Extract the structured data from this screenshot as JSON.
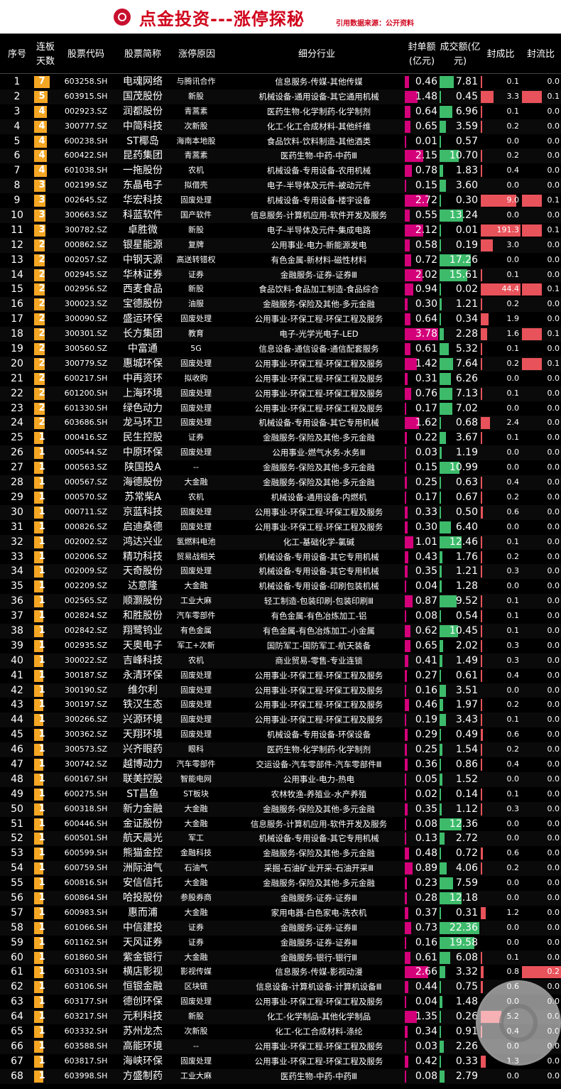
{
  "header": {
    "title": "点金投资---涨停探秘",
    "source": "引用数据来源：公开资料"
  },
  "columns": {
    "seq": "序号",
    "lianban": "连板天数",
    "code": "股票代码",
    "name": "股票简称",
    "reason": "涨停原因",
    "industry": "细分行业",
    "fengdan": "封单额(亿元)",
    "volume": "成交额(亿元)",
    "fengcheng": "封成比",
    "fengliu": "封流比"
  },
  "colors": {
    "lianban": "#f5a623",
    "fengdan": "#d4007a",
    "volume": "#3dbb6b",
    "ratio": "#e8525a",
    "title": "#d0021b"
  },
  "rows": [
    [
      "1",
      "7",
      "603258.SH",
      "电魂网络",
      "与腾讯合作",
      "信息服务-传媒-其他传媒",
      "0.46",
      "7.81",
      "0.1",
      "0.0"
    ],
    [
      "2",
      "5",
      "603915.SH",
      "国茂股份",
      "新股",
      "机械设备-通用设备-其它通用机械",
      "1.48",
      "0.45",
      "3.3",
      "0.1"
    ],
    [
      "3",
      "4",
      "002923.SZ",
      "润都股份",
      "青蒿素",
      "医药生物-化学制药-化学制剂",
      "0.64",
      "6.96",
      "0.1",
      "0.0"
    ],
    [
      "4",
      "4",
      "300777.SZ",
      "中简科技",
      "次新股",
      "化工-化工合成材料-其他纤维",
      "0.65",
      "3.59",
      "0.2",
      "0.0"
    ],
    [
      "5",
      "4",
      "600238.SH",
      "ST椰岛",
      "海南本地股",
      "食品饮料-饮料制造-其他酒类",
      "0.01",
      "0.57",
      "0.0",
      "0.0"
    ],
    [
      "6",
      "4",
      "600422.SH",
      "昆药集团",
      "青蒿素",
      "医药生物-中药-中药Ⅲ",
      "2.15",
      "10.70",
      "0.2",
      "0.0"
    ],
    [
      "7",
      "4",
      "601038.SH",
      "一拖股份",
      "农机",
      "机械设备-专用设备-农用机械",
      "0.78",
      "1.83",
      "0.4",
      "0.0"
    ],
    [
      "8",
      "3",
      "002199.SZ",
      "东晶电子",
      "拟借壳",
      "电子-半导体及元件-被动元件",
      "0.15",
      "3.60",
      "0.0",
      "0.0"
    ],
    [
      "9",
      "3",
      "002645.SZ",
      "华宏科技",
      "固废处理",
      "机械设备-专用设备-楼宇设备",
      "2.72",
      "0.30",
      "9.0",
      "0.1"
    ],
    [
      "10",
      "3",
      "300663.SZ",
      "科蓝软件",
      "国产软件",
      "信息服务-计算机应用-软件开发及服务",
      "0.55",
      "13.24",
      "0.0",
      "0.0"
    ],
    [
      "11",
      "3",
      "300782.SZ",
      "卓胜微",
      "新股",
      "电子-半导体及元件-集成电路",
      "2.12",
      "0.01",
      "191.3",
      "0.1"
    ],
    [
      "12",
      "2",
      "000862.SZ",
      "银星能源",
      "复牌",
      "公用事业-电力-新能源发电",
      "0.58",
      "0.19",
      "3.0",
      "0.0"
    ],
    [
      "13",
      "2",
      "002057.SZ",
      "中钢天源",
      "高送转错权",
      "有色金属-新材料-磁性材料",
      "0.72",
      "17.26",
      "0.0",
      "0.0"
    ],
    [
      "14",
      "2",
      "002945.SZ",
      "华林证券",
      "证券",
      "金融服务-证券-证券Ⅲ",
      "2.02",
      "15.61",
      "0.1",
      "0.0"
    ],
    [
      "15",
      "2",
      "002956.SZ",
      "西麦食品",
      "新股",
      "食品饮料-食品加工制造-食品综合",
      "0.94",
      "0.02",
      "44.4",
      "0.1"
    ],
    [
      "16",
      "2",
      "300023.SZ",
      "宝德股份",
      "油服",
      "金融服务-保险及其他-多元金融",
      "0.30",
      "1.21",
      "0.2",
      "0.0"
    ],
    [
      "17",
      "2",
      "300090.SZ",
      "盛运环保",
      "固废处理",
      "公用事业-环保工程-环保工程及服务",
      "0.64",
      "0.34",
      "1.9",
      "0.0"
    ],
    [
      "18",
      "2",
      "300301.SZ",
      "长方集团",
      "教育",
      "电子-光学光电子-LED",
      "3.78",
      "2.28",
      "1.6",
      "0.1"
    ],
    [
      "19",
      "2",
      "300560.SZ",
      "中富通",
      "5G",
      "信息设备-通信设备-通信配套服务",
      "0.61",
      "5.32",
      "0.1",
      "0.0"
    ],
    [
      "20",
      "2",
      "300779.SZ",
      "惠城环保",
      "固废处理",
      "公用事业-环保工程-环保工程及服务",
      "1.42",
      "7.64",
      "0.2",
      "0.1"
    ],
    [
      "21",
      "2",
      "600217.SH",
      "中再资环",
      "拟收购",
      "公用事业-环保工程-环保工程及服务",
      "0.31",
      "6.26",
      "0.0",
      "0.0"
    ],
    [
      "22",
      "2",
      "601200.SH",
      "上海环境",
      "固废处理",
      "公用事业-环保工程-环保工程及服务",
      "0.76",
      "7.13",
      "0.1",
      "0.0"
    ],
    [
      "23",
      "2",
      "601330.SH",
      "绿色动力",
      "固废处理",
      "公用事业-环保工程-环保工程及服务",
      "0.17",
      "7.02",
      "0.0",
      "0.0"
    ],
    [
      "24",
      "2",
      "603686.SH",
      "龙马环卫",
      "固废处理",
      "机械设备-专用设备-其它专用机械",
      "1.62",
      "0.68",
      "2.4",
      "0.0"
    ],
    [
      "25",
      "1",
      "000416.SZ",
      "民生控股",
      "证券",
      "金融服务-保险及其他-多元金融",
      "0.22",
      "3.67",
      "0.1",
      "0.0"
    ],
    [
      "26",
      "1",
      "000544.SZ",
      "中原环保",
      "固废处理",
      "公用事业-燃气水务-水务Ⅲ",
      "0.03",
      "1.19",
      "0.0",
      "0.0"
    ],
    [
      "27",
      "1",
      "000563.SZ",
      "陕国投A",
      "--",
      "金融服务-保险及其他-多元金融",
      "0.15",
      "10.99",
      "0.0",
      "0.0"
    ],
    [
      "28",
      "1",
      "000567.SZ",
      "海德股份",
      "大金融",
      "金融服务-保险及其他-多元金融",
      "0.25",
      "0.63",
      "0.4",
      "0.0"
    ],
    [
      "29",
      "1",
      "000570.SZ",
      "苏常柴A",
      "农机",
      "机械设备-通用设备-内燃机",
      "0.17",
      "0.67",
      "0.2",
      "0.0"
    ],
    [
      "30",
      "1",
      "000711.SZ",
      "京蓝科技",
      "固废处理",
      "公用事业-环保工程-环保工程及服务",
      "0.33",
      "0.50",
      "0.6",
      "0.0"
    ],
    [
      "31",
      "1",
      "000826.SZ",
      "启迪桑德",
      "固废处理",
      "公用事业-环保工程-环保工程及服务",
      "0.30",
      "6.40",
      "0.0",
      "0.0"
    ],
    [
      "32",
      "1",
      "002002.SZ",
      "鸿达兴业",
      "氢燃料电池",
      "化工-基础化学-氯碱",
      "1.01",
      "12.46",
      "0.1",
      "0.0"
    ],
    [
      "33",
      "1",
      "002006.SZ",
      "精功科技",
      "贸易战相关",
      "机械设备-专用设备-其它专用机械",
      "0.43",
      "1.76",
      "0.2",
      "0.0"
    ],
    [
      "34",
      "1",
      "002009.SZ",
      "天奇股份",
      "固废处理",
      "机械设备-专用设备-其它专用机械",
      "0.35",
      "1.21",
      "0.3",
      "0.0"
    ],
    [
      "35",
      "1",
      "002209.SZ",
      "达意隆",
      "大金融",
      "机械设备-专用设备-印刷包装机械",
      "0.04",
      "1.28",
      "0.0",
      "0.0"
    ],
    [
      "36",
      "1",
      "002565.SZ",
      "顺灏股份",
      "工业大麻",
      "轻工制造-包装印刷-包装印刷Ⅲ",
      "0.87",
      "9.52",
      "0.1",
      "0.0"
    ],
    [
      "37",
      "1",
      "002824.SZ",
      "和胜股份",
      "汽车零部件",
      "有色金属-有色冶炼加工-铝",
      "0.08",
      "0.54",
      "0.1",
      "0.0"
    ],
    [
      "38",
      "1",
      "002842.SZ",
      "翔鹭钨业",
      "有色金属",
      "有色金属-有色冶炼加工-小金属",
      "0.62",
      "10.45",
      "0.1",
      "0.0"
    ],
    [
      "39",
      "1",
      "002935.SZ",
      "天奥电子",
      "军工+次新",
      "国防军工-国防军工-航天装备",
      "0.65",
      "2.02",
      "0.3",
      "0.0"
    ],
    [
      "40",
      "1",
      "300022.SZ",
      "吉峰科技",
      "农机",
      "商业贸易-零售-专业连锁",
      "0.41",
      "1.49",
      "0.3",
      "0.0"
    ],
    [
      "41",
      "1",
      "300187.SZ",
      "永清环保",
      "固废处理",
      "公用事业-环保工程-环保工程及服务",
      "0.27",
      "0.61",
      "0.4",
      "0.0"
    ],
    [
      "42",
      "1",
      "300190.SZ",
      "维尔利",
      "固废处理",
      "公用事业-环保工程-环保工程及服务",
      "0.16",
      "3.51",
      "0.0",
      "0.0"
    ],
    [
      "43",
      "1",
      "300197.SZ",
      "铁汉生态",
      "固废处理",
      "公用事业-环保工程-环保工程及服务",
      "0.46",
      "1.97",
      "0.2",
      "0.0"
    ],
    [
      "44",
      "1",
      "300266.SZ",
      "兴源环境",
      "固废处理",
      "公用事业-环保工程-环保工程及服务",
      "0.19",
      "3.43",
      "0.1",
      "0.0"
    ],
    [
      "45",
      "1",
      "300362.SZ",
      "天翔环境",
      "固废处理",
      "机械设备-专用设备-环保设备",
      "0.29",
      "0.49",
      "0.6",
      "0.0"
    ],
    [
      "46",
      "1",
      "300573.SZ",
      "兴齐眼药",
      "眼科",
      "医药生物-化学制药-化学制剂",
      "0.25",
      "1.54",
      "0.2",
      "0.0"
    ],
    [
      "47",
      "1",
      "300742.SZ",
      "越博动力",
      "汽车零部件",
      "交运设备-汽车零部件-汽车零部件Ⅲ",
      "0.36",
      "0.86",
      "0.4",
      "0.0"
    ],
    [
      "48",
      "1",
      "600167.SH",
      "联美控股",
      "智能电网",
      "公用事业-电力-热电",
      "0.05",
      "1.52",
      "0.0",
      "0.0"
    ],
    [
      "49",
      "1",
      "600275.SH",
      "ST昌鱼",
      "ST板块",
      "农林牧渔-养殖业-水产养殖",
      "0.02",
      "0.14",
      "0.1",
      "0.0"
    ],
    [
      "50",
      "1",
      "600318.SH",
      "新力金融",
      "大金融",
      "金融服务-保险及其他-多元金融",
      "0.35",
      "1.12",
      "0.3",
      "0.0"
    ],
    [
      "51",
      "1",
      "600446.SH",
      "金证股份",
      "大金融",
      "信息服务-计算机应用-软件开发及服务",
      "0.08",
      "12.36",
      "0.0",
      "0.0"
    ],
    [
      "52",
      "1",
      "600501.SH",
      "航天晨光",
      "军工",
      "机械设备-专用设备-其它专用机械",
      "0.13",
      "2.72",
      "0.0",
      "0.0"
    ],
    [
      "53",
      "1",
      "600599.SH",
      "熊猫金控",
      "金融科技",
      "金融服务-保险及其他-多元金融",
      "0.48",
      "0.72",
      "0.6",
      "0.0"
    ],
    [
      "54",
      "1",
      "600759.SH",
      "洲际油气",
      "石油气",
      "采掘-石油矿业开采-石油开采Ⅲ",
      "0.89",
      "4.06",
      "0.2",
      "0.0"
    ],
    [
      "55",
      "1",
      "600816.SH",
      "安信信托",
      "大金融",
      "金融服务-保险及其他-多元金融",
      "0.23",
      "7.59",
      "0.0",
      "0.0"
    ],
    [
      "56",
      "1",
      "600864.SH",
      "哈投股份",
      "参股券商",
      "金融服务-证券-证券Ⅲ",
      "0.28",
      "12.18",
      "0.0",
      "0.0"
    ],
    [
      "57",
      "1",
      "600983.SH",
      "惠而浦",
      "大金融",
      "家用电器-白色家电-洗衣机",
      "0.37",
      "0.31",
      "1.2",
      "0.0"
    ],
    [
      "58",
      "1",
      "601066.SH",
      "中信建投",
      "证券",
      "金融服务-证券-证券Ⅲ",
      "0.73",
      "22.36",
      "0.0",
      "0.0"
    ],
    [
      "59",
      "1",
      "601162.SH",
      "天风证券",
      "证券",
      "金融服务-证券-证券Ⅲ",
      "0.16",
      "19.58",
      "0.0",
      "0.0"
    ],
    [
      "60",
      "1",
      "601860.SH",
      "紫金银行",
      "大金融",
      "金融服务-银行-银行Ⅲ",
      "0.61",
      "6.08",
      "0.1",
      "0.0"
    ],
    [
      "61",
      "1",
      "603103.SH",
      "横店影视",
      "影视传媒",
      "信息服务-传媒-影视动漫",
      "2.66",
      "3.32",
      "0.8",
      "0.2"
    ],
    [
      "62",
      "1",
      "603106.SH",
      "恒银金融",
      "区块链",
      "信息设备-计算机设备-计算机设备Ⅲ",
      "0.44",
      "0.75",
      "0.6",
      "0.0"
    ],
    [
      "63",
      "1",
      "603177.SH",
      "德创环保",
      "固废处理",
      "公用事业-环保工程-环保工程及服务",
      "0.04",
      "1.48",
      "0.0",
      "0.0"
    ],
    [
      "64",
      "1",
      "603217.SH",
      "元利科技",
      "新股",
      "化工-化学制品-其他化学制品",
      "1.35",
      "0.26",
      "5.2",
      "0.0"
    ],
    [
      "65",
      "1",
      "603332.SH",
      "苏州龙杰",
      "次新股",
      "化工-化工合成材料-涤纶",
      "0.34",
      "0.91",
      "0.4",
      "0.0"
    ],
    [
      "66",
      "1",
      "603588.SH",
      "高能环境",
      "--",
      "公用事业-环保工程-环保工程及服务",
      "0.03",
      "2.26",
      "0.0",
      "0.0"
    ],
    [
      "67",
      "1",
      "603817.SH",
      "海峡环保",
      "固废处理",
      "公用事业-环保工程-环保工程及服务",
      "0.42",
      "0.33",
      "1.3",
      "0.0"
    ],
    [
      "68",
      "1",
      "603998.SH",
      "方盛制药",
      "工业大麻",
      "医药生物-中药-中药Ⅲ",
      "0.08",
      "2.79",
      "0.0",
      "0.0"
    ]
  ]
}
